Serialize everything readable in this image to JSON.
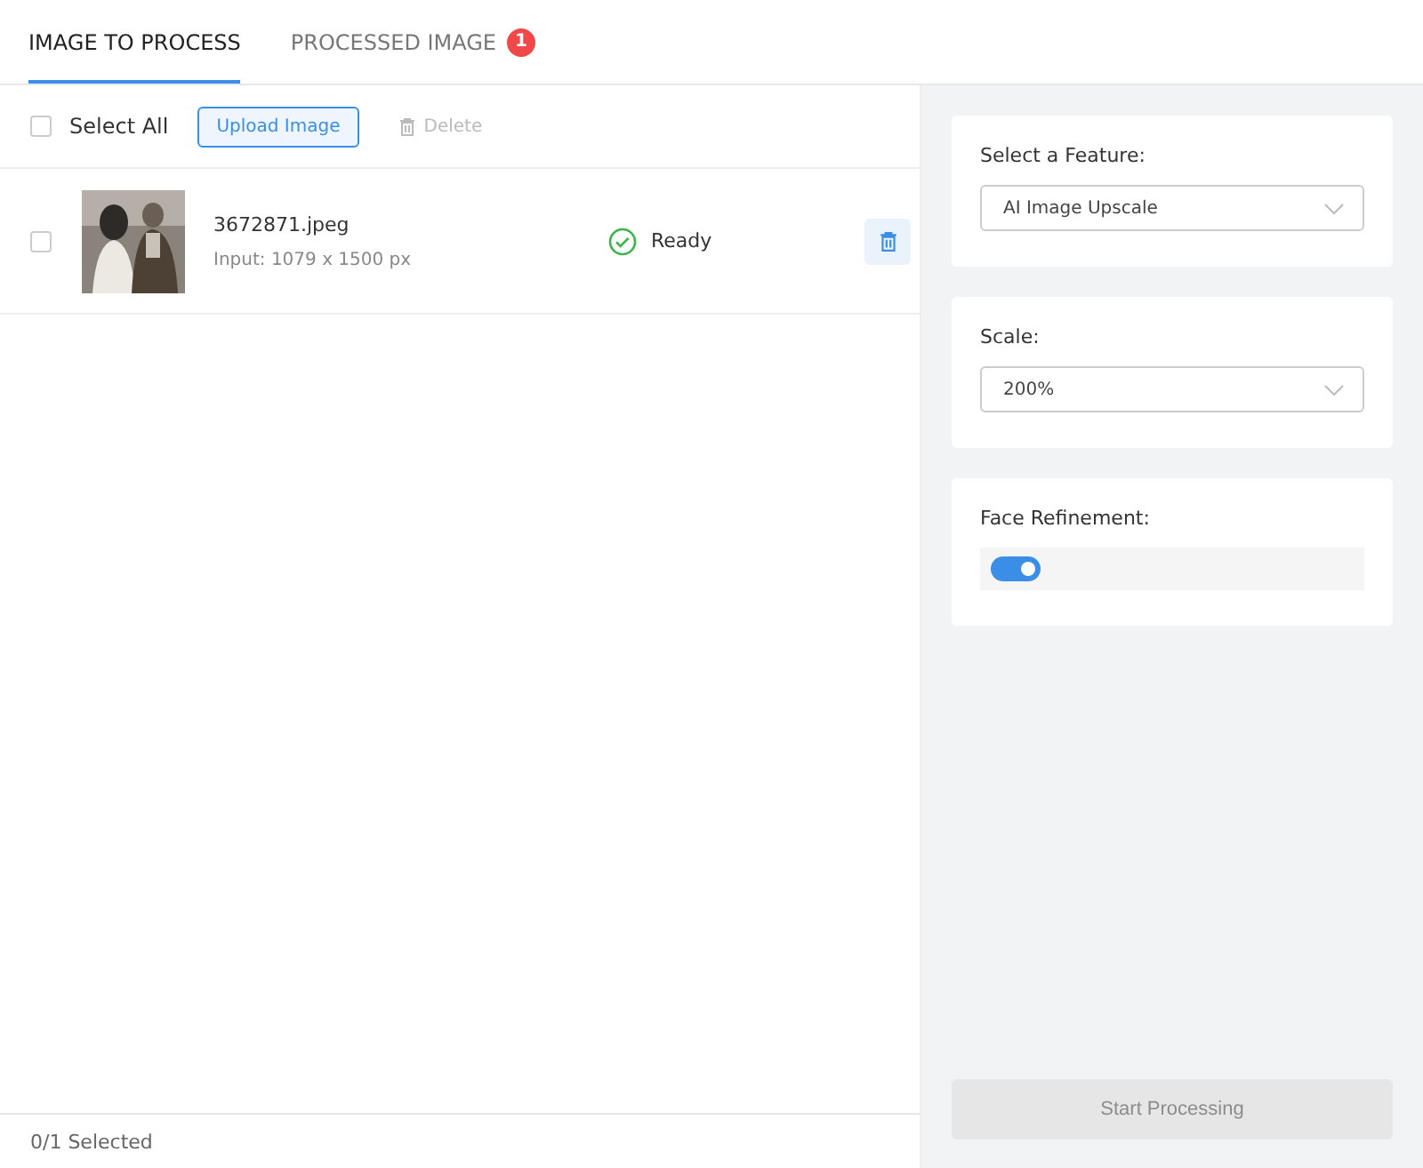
{
  "tabs": [
    {
      "label": "IMAGE TO PROCESS",
      "selected": true
    },
    {
      "label": "PROCESSED IMAGE",
      "selected": false,
      "badge": "1"
    }
  ],
  "toolbar": {
    "select_all": {
      "label": "Select All",
      "checked": false
    },
    "upload_button": "Upload Image",
    "delete_button": {
      "label": "Delete",
      "disabled": true
    }
  },
  "files": [
    {
      "name": "3672871.jpeg",
      "info": "Input: 1079 x 1500 px",
      "status": "Ready",
      "checked": false
    }
  ],
  "footer": {
    "selection": "0/1 Selected"
  },
  "settings": [
    {
      "kind": "select",
      "label": "Select a Feature:",
      "value": "AI Image Upscale"
    },
    {
      "kind": "select",
      "label": "Scale:",
      "value": "200%"
    },
    {
      "kind": "toggle",
      "label": "Face Refinement:",
      "on": true
    }
  ],
  "start_button": {
    "label": "Start Processing",
    "disabled": true
  }
}
